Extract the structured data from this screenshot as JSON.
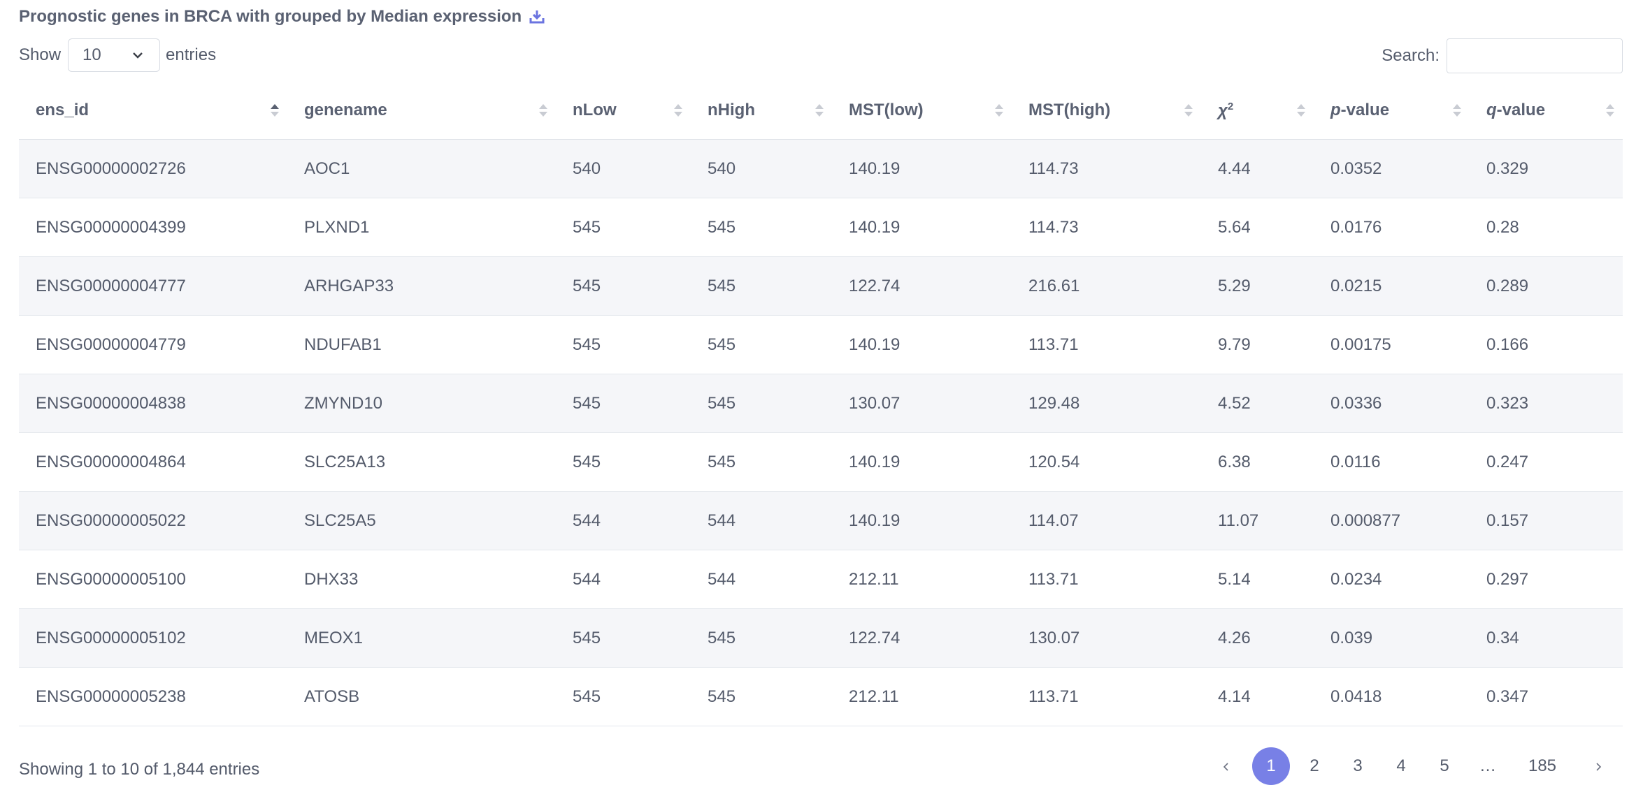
{
  "title": "Prognostic genes in BRCA with grouped by Median expression",
  "icons": {
    "download": "download-icon",
    "caret": "chevron-down-icon",
    "prev": "chevron-left-icon",
    "next": "chevron-right-icon"
  },
  "colors": {
    "accent": "#7880e6",
    "stripe": "#f5f6f9",
    "text": "#545b6b"
  },
  "length": {
    "show_label": "Show",
    "value": "10",
    "entries_label": "entries"
  },
  "search": {
    "label": "Search:",
    "value": "",
    "placeholder": ""
  },
  "table": {
    "columns": [
      {
        "key": "ens_id",
        "label": "ens_id"
      },
      {
        "key": "genename",
        "label": "genename"
      },
      {
        "key": "nlow",
        "label": "nLow"
      },
      {
        "key": "nhigh",
        "label": "nHigh"
      },
      {
        "key": "mstlow",
        "label": "MST(low)"
      },
      {
        "key": "msthigh",
        "label": "MST(high)"
      },
      {
        "key": "chi2",
        "label": "χ",
        "sup": "2"
      },
      {
        "key": "pvalue",
        "label": "p",
        "suffix": "-value"
      },
      {
        "key": "qvalue",
        "label": "q",
        "suffix": "-value"
      }
    ],
    "sorted_by": "ens_id",
    "rows": [
      [
        "ENSG00000002726",
        "AOC1",
        "540",
        "540",
        "140.19",
        "114.73",
        "4.44",
        "0.0352",
        "0.329"
      ],
      [
        "ENSG00000004399",
        "PLXND1",
        "545",
        "545",
        "140.19",
        "114.73",
        "5.64",
        "0.0176",
        "0.28"
      ],
      [
        "ENSG00000004777",
        "ARHGAP33",
        "545",
        "545",
        "122.74",
        "216.61",
        "5.29",
        "0.0215",
        "0.289"
      ],
      [
        "ENSG00000004779",
        "NDUFAB1",
        "545",
        "545",
        "140.19",
        "113.71",
        "9.79",
        "0.00175",
        "0.166"
      ],
      [
        "ENSG00000004838",
        "ZMYND10",
        "545",
        "545",
        "130.07",
        "129.48",
        "4.52",
        "0.0336",
        "0.323"
      ],
      [
        "ENSG00000004864",
        "SLC25A13",
        "545",
        "545",
        "140.19",
        "120.54",
        "6.38",
        "0.0116",
        "0.247"
      ],
      [
        "ENSG00000005022",
        "SLC25A5",
        "544",
        "544",
        "140.19",
        "114.07",
        "11.07",
        "0.000877",
        "0.157"
      ],
      [
        "ENSG00000005100",
        "DHX33",
        "544",
        "544",
        "212.11",
        "113.71",
        "5.14",
        "0.0234",
        "0.297"
      ],
      [
        "ENSG00000005102",
        "MEOX1",
        "545",
        "545",
        "122.74",
        "130.07",
        "4.26",
        "0.039",
        "0.34"
      ],
      [
        "ENSG00000005238",
        "ATOSB",
        "545",
        "545",
        "212.11",
        "113.71",
        "4.14",
        "0.0418",
        "0.347"
      ]
    ]
  },
  "info": "Showing 1 to 10 of 1,844 entries",
  "pagination": {
    "pages": [
      "1",
      "2",
      "3",
      "4",
      "5",
      "…",
      "185"
    ],
    "current": "1"
  }
}
